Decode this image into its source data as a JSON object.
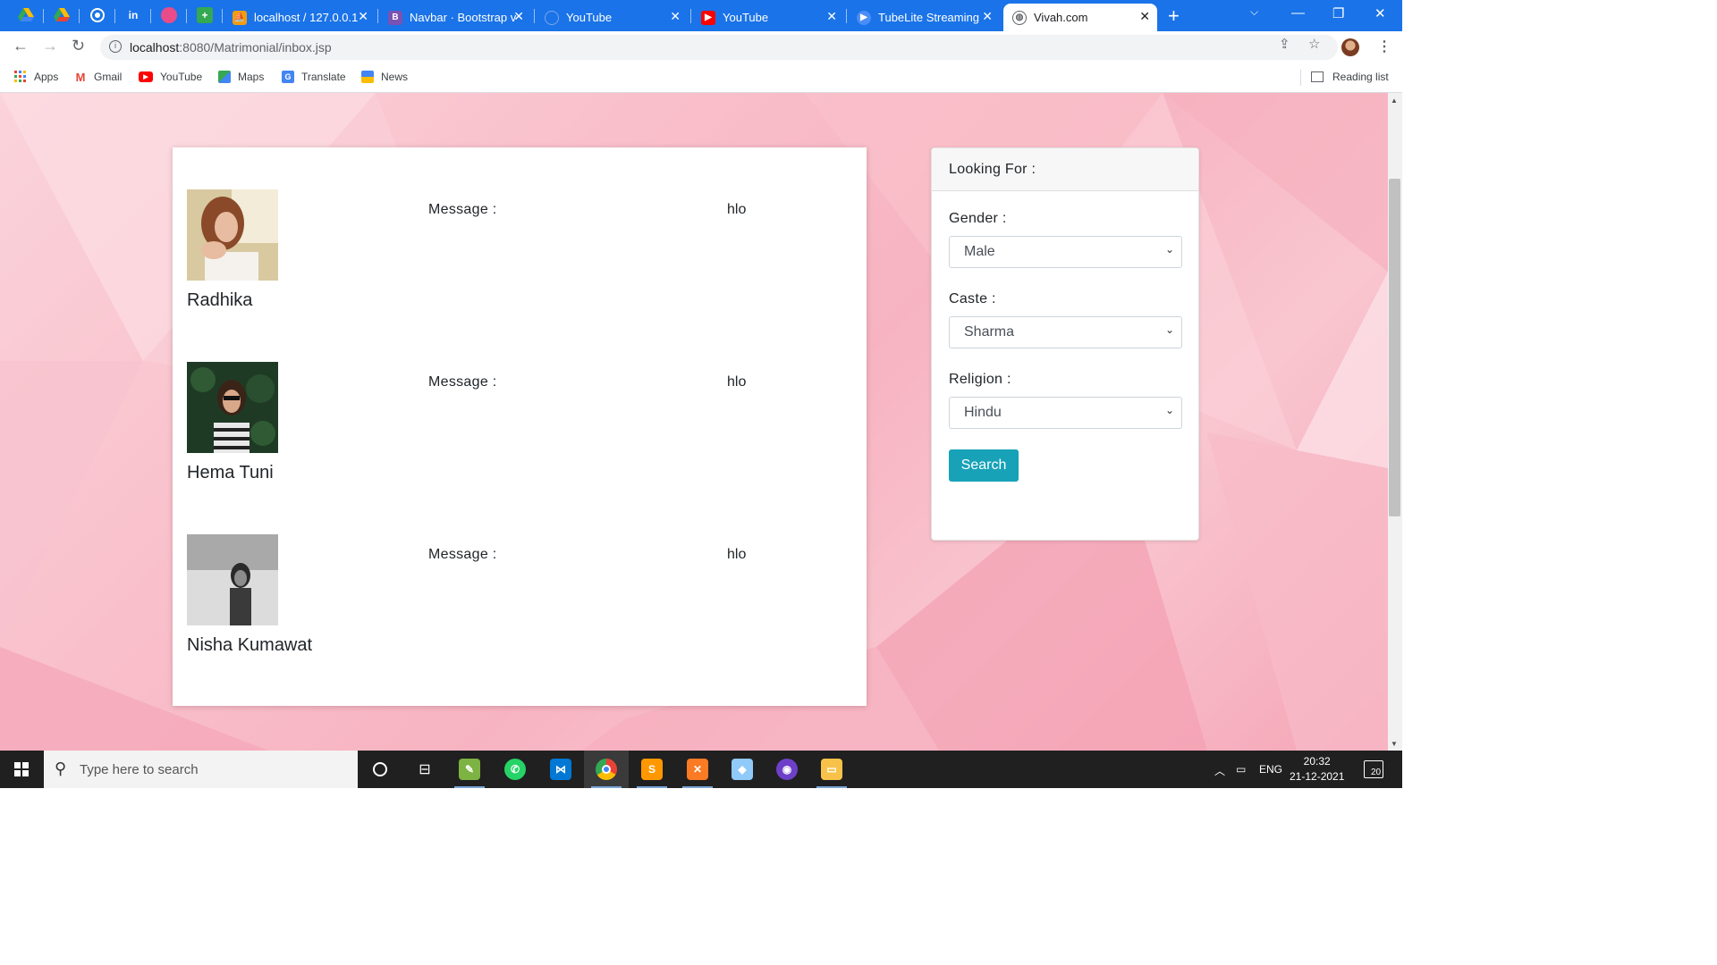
{
  "browser": {
    "tabs": [
      {
        "label": "localhost / 127.0.0.1",
        "active": false
      },
      {
        "label": "Navbar · Bootstrap v",
        "active": false
      },
      {
        "label": "YouTube",
        "active": false
      },
      {
        "label": "YouTube",
        "active": false
      },
      {
        "label": "TubeLite Streaming",
        "active": false
      },
      {
        "label": "Vivah.com",
        "active": true
      }
    ],
    "url_host": "localhost",
    "url_path": ":8080/Matrimonial/inbox.jsp",
    "bookmarks": [
      {
        "label": "Apps",
        "icon": "apps-grid-icon"
      },
      {
        "label": "Gmail",
        "icon": "gmail-icon"
      },
      {
        "label": "YouTube",
        "icon": "youtube-icon"
      },
      {
        "label": "Maps",
        "icon": "maps-icon"
      },
      {
        "label": "Translate",
        "icon": "translate-icon"
      },
      {
        "label": "News",
        "icon": "news-icon"
      }
    ],
    "reading_list": "Reading list"
  },
  "inbox": {
    "messages": [
      {
        "name": "Radhika",
        "label": "Message :",
        "text": "hlo"
      },
      {
        "name": "Hema Tuni",
        "label": "Message :",
        "text": "hlo"
      },
      {
        "name": "Nisha Kumawat",
        "label": "Message :",
        "text": "hlo"
      }
    ]
  },
  "search_panel": {
    "header": "Looking For :",
    "gender": {
      "label": "Gender :",
      "value": "Male"
    },
    "caste": {
      "label": "Caste :",
      "value": "Sharma"
    },
    "religion": {
      "label": "Religion :",
      "value": "Hindu"
    },
    "button": "Search"
  },
  "taskbar": {
    "search_placeholder": "Type here to search",
    "language": "ENG",
    "time": "20:32",
    "date": "21-12-2021",
    "notifications": "20"
  },
  "colors": {
    "browser_blue": "#1a73e8",
    "button_teal": "#17a2b8",
    "page_pink": "#f7b3c1"
  }
}
